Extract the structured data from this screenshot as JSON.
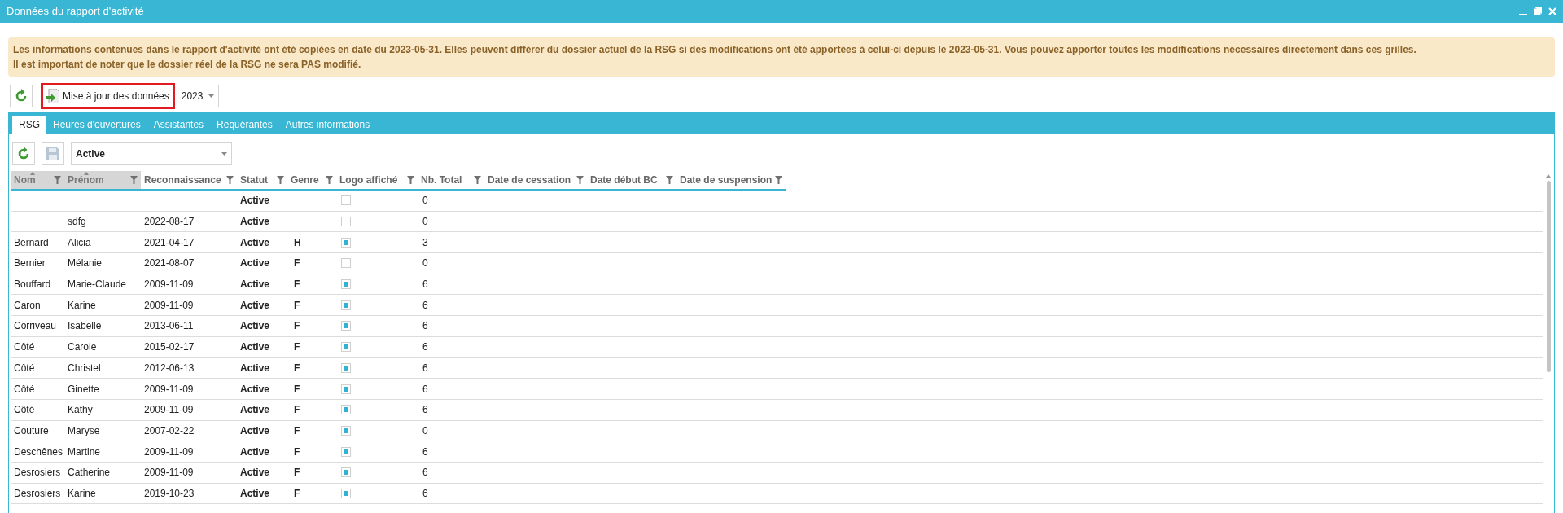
{
  "window": {
    "title": "Données du rapport d'activité"
  },
  "banner": {
    "lines": [
      "Les informations contenues dans le rapport d'activité ont été copiées en date du 2023-05-31. Elles peuvent différer du dossier actuel de la RSG si des modifications ont été apportées à celui-ci depuis le 2023-05-31. Vous pouvez apporter toutes les modifications nécessaires directement dans ces grilles.",
      "Il est important de noter que le dossier réel de la RSG ne sera PAS modifié."
    ]
  },
  "toolbar": {
    "update_button": {
      "label": "Mise à jour des données",
      "highlighted": true
    },
    "year": "2023"
  },
  "tabs": [
    {
      "label": "RSG",
      "selected": true
    },
    {
      "label": "Heures d'ouvertures",
      "selected": false
    },
    {
      "label": "Assistantes",
      "selected": false
    },
    {
      "label": "Requérantes",
      "selected": false
    },
    {
      "label": "Autres informations",
      "selected": false
    }
  ],
  "filter": {
    "value": "Active"
  },
  "table": {
    "columns": [
      {
        "label": "Nom",
        "sorted": true
      },
      {
        "label": "Prénom",
        "sorted": true
      },
      {
        "label": "Reconnaissance",
        "sorted": false
      },
      {
        "label": "Statut",
        "sorted": false
      },
      {
        "label": "Genre",
        "sorted": false
      },
      {
        "label": "Logo affiché",
        "sorted": false
      },
      {
        "label": "Nb. Total",
        "sorted": false
      },
      {
        "label": "Date de cessation",
        "sorted": false
      },
      {
        "label": "Date début BC",
        "sorted": false
      },
      {
        "label": "Date de suspension",
        "sorted": false
      }
    ],
    "rows": [
      {
        "nom": "",
        "prenom": "",
        "reconnaissance": "",
        "statut": "Active",
        "genre": "",
        "logo": false,
        "nb": "0"
      },
      {
        "nom": "",
        "prenom": "sdfg",
        "reconnaissance": "2022-08-17",
        "statut": "Active",
        "genre": "",
        "logo": false,
        "nb": "0"
      },
      {
        "nom": "Bernard",
        "prenom": "Alicia",
        "reconnaissance": "2021-04-17",
        "statut": "Active",
        "genre": "H",
        "logo": true,
        "nb": "3"
      },
      {
        "nom": "Bernier",
        "prenom": "Mélanie",
        "reconnaissance": "2021-08-07",
        "statut": "Active",
        "genre": "F",
        "logo": false,
        "nb": "0"
      },
      {
        "nom": "Bouffard",
        "prenom": "Marie-Claude",
        "reconnaissance": "2009-11-09",
        "statut": "Active",
        "genre": "F",
        "logo": true,
        "nb": "6"
      },
      {
        "nom": "Caron",
        "prenom": "Karine",
        "reconnaissance": "2009-11-09",
        "statut": "Active",
        "genre": "F",
        "logo": true,
        "nb": "6"
      },
      {
        "nom": "Corriveau",
        "prenom": "Isabelle",
        "reconnaissance": "2013-06-11",
        "statut": "Active",
        "genre": "F",
        "logo": true,
        "nb": "6"
      },
      {
        "nom": "Côté",
        "prenom": "Carole",
        "reconnaissance": "2015-02-17",
        "statut": "Active",
        "genre": "F",
        "logo": true,
        "nb": "6"
      },
      {
        "nom": "Côté",
        "prenom": "Christel",
        "reconnaissance": "2012-06-13",
        "statut": "Active",
        "genre": "F",
        "logo": true,
        "nb": "6"
      },
      {
        "nom": "Côté",
        "prenom": "Ginette",
        "reconnaissance": "2009-11-09",
        "statut": "Active",
        "genre": "F",
        "logo": true,
        "nb": "6"
      },
      {
        "nom": "Côté",
        "prenom": "Kathy",
        "reconnaissance": "2009-11-09",
        "statut": "Active",
        "genre": "F",
        "logo": true,
        "nb": "6"
      },
      {
        "nom": "Couture",
        "prenom": "Maryse",
        "reconnaissance": "2007-02-22",
        "statut": "Active",
        "genre": "F",
        "logo": true,
        "nb": "0"
      },
      {
        "nom": "Deschênes",
        "prenom": "Martine",
        "reconnaissance": "2009-11-09",
        "statut": "Active",
        "genre": "F",
        "logo": true,
        "nb": "6"
      },
      {
        "nom": "Desrosiers",
        "prenom": "Catherine",
        "reconnaissance": "2009-11-09",
        "statut": "Active",
        "genre": "F",
        "logo": true,
        "nb": "6"
      },
      {
        "nom": "Desrosiers",
        "prenom": "Karine",
        "reconnaissance": "2019-10-23",
        "statut": "Active",
        "genre": "F",
        "logo": true,
        "nb": "6"
      }
    ]
  }
}
